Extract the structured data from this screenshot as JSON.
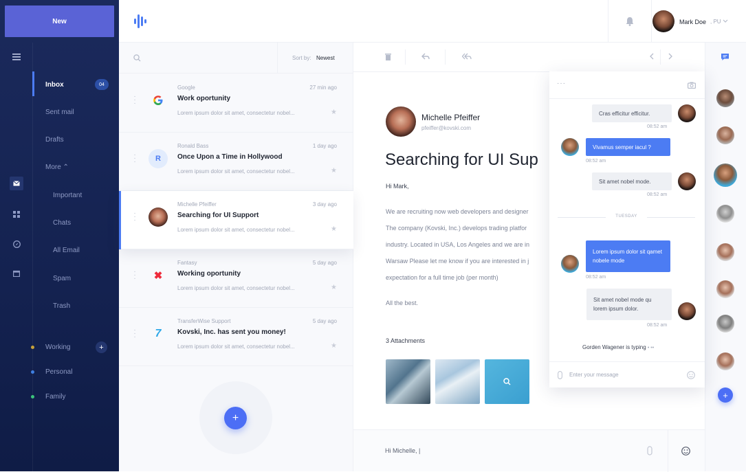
{
  "sidebar": {
    "new_label": "New",
    "folders": [
      {
        "label": "Inbox",
        "badge": "04"
      },
      {
        "label": "Sent mail"
      },
      {
        "label": "Drafts"
      },
      {
        "label": "More ⌃"
      },
      {
        "label": "Important"
      },
      {
        "label": "Chats"
      },
      {
        "label": "All Email"
      },
      {
        "label": "Spam"
      },
      {
        "label": "Trash"
      }
    ],
    "labels": [
      {
        "label": "Working",
        "color": "#c7a23a"
      },
      {
        "label": "Personal",
        "color": "#3f7fe0"
      },
      {
        "label": "Family",
        "color": "#3cc47c"
      }
    ],
    "rail_icons": [
      "menu-icon",
      "mail-icon",
      "dashboard-icon",
      "compass-icon",
      "calendar-icon"
    ]
  },
  "header": {
    "user_name": "Mark Doe",
    "user_role": ", PU"
  },
  "list": {
    "sort_label": "Sort by:",
    "sort_value": "Newest",
    "emails": [
      {
        "sender": "Google",
        "time": "27 min ago",
        "subject": "Work oportunity",
        "preview": "Lorem ipsum dolor sit amet, consectetur nobel...",
        "icon": "G"
      },
      {
        "sender": "Ronald Bass",
        "time": "1 day ago",
        "subject": "Once Upon a Time in Hollywood",
        "preview": "Lorem ipsum dolor sit amet, consectetur nobel...",
        "icon": "R"
      },
      {
        "sender": "Michelle Pfeiffer",
        "time": "3 day ago",
        "subject": "Searching for UI Support",
        "preview": "Lorem ipsum dolor sit amet, consectetur nobel...",
        "icon": ""
      },
      {
        "sender": "Fantasy",
        "time": "5 day ago",
        "subject": "Working oportunity",
        "preview": "Lorem ipsum dolor sit amet, consectetur nobel...",
        "icon": "✖"
      },
      {
        "sender": "TransferWise Support",
        "time": "5 day ago",
        "subject": "Kovski, Inc. has sent you money!",
        "preview": "Lorem ipsum dolor sit amet, consectetur nobel...",
        "icon": "7"
      }
    ]
  },
  "reader": {
    "from_name": "Michelle Pfeiffer",
    "from_email": "pfeiffer@kovski.com",
    "subject": "Searching for UI Sup",
    "greeting": "Hi Mark,",
    "body": [
      "We are recruiting now web developers and designer",
      "The company (Kovski, Inc.) develops trading platfor",
      "industry. Located in USA, Los Angeles and we are in",
      "Warsaw Please let me know if you are interested in j",
      "expectation for a full time job (per month)"
    ],
    "signoff": "All the best.",
    "attachments_label": "3 Attachments",
    "reply_text": "Hi Michelle, |"
  },
  "chat": {
    "messages": [
      {
        "text": "Cras efficitur efficitur.",
        "time": "08:52 am",
        "dir": "in"
      },
      {
        "text": "Vivamus semper iacul ?",
        "time": "08:52 am",
        "dir": "out"
      },
      {
        "text": "Sit amet nobel mode.",
        "time": "08:52 am",
        "dir": "in"
      },
      {
        "text": "Lorem ipsum dolor sit qamet nobele mode",
        "time": "08:52 am",
        "dir": "out"
      },
      {
        "text": "Sit amet nobel mode qu lorem ipsum dolor.",
        "time": "08:52 am",
        "dir": "in"
      }
    ],
    "divider": "TUESDAY",
    "typing": "Gorden Wagener is typing",
    "input_placeholder": "Enter your message"
  },
  "colors": {
    "accent": "#4c7cf3",
    "sidebar": "#142250",
    "new_button": "#5a63d6"
  }
}
